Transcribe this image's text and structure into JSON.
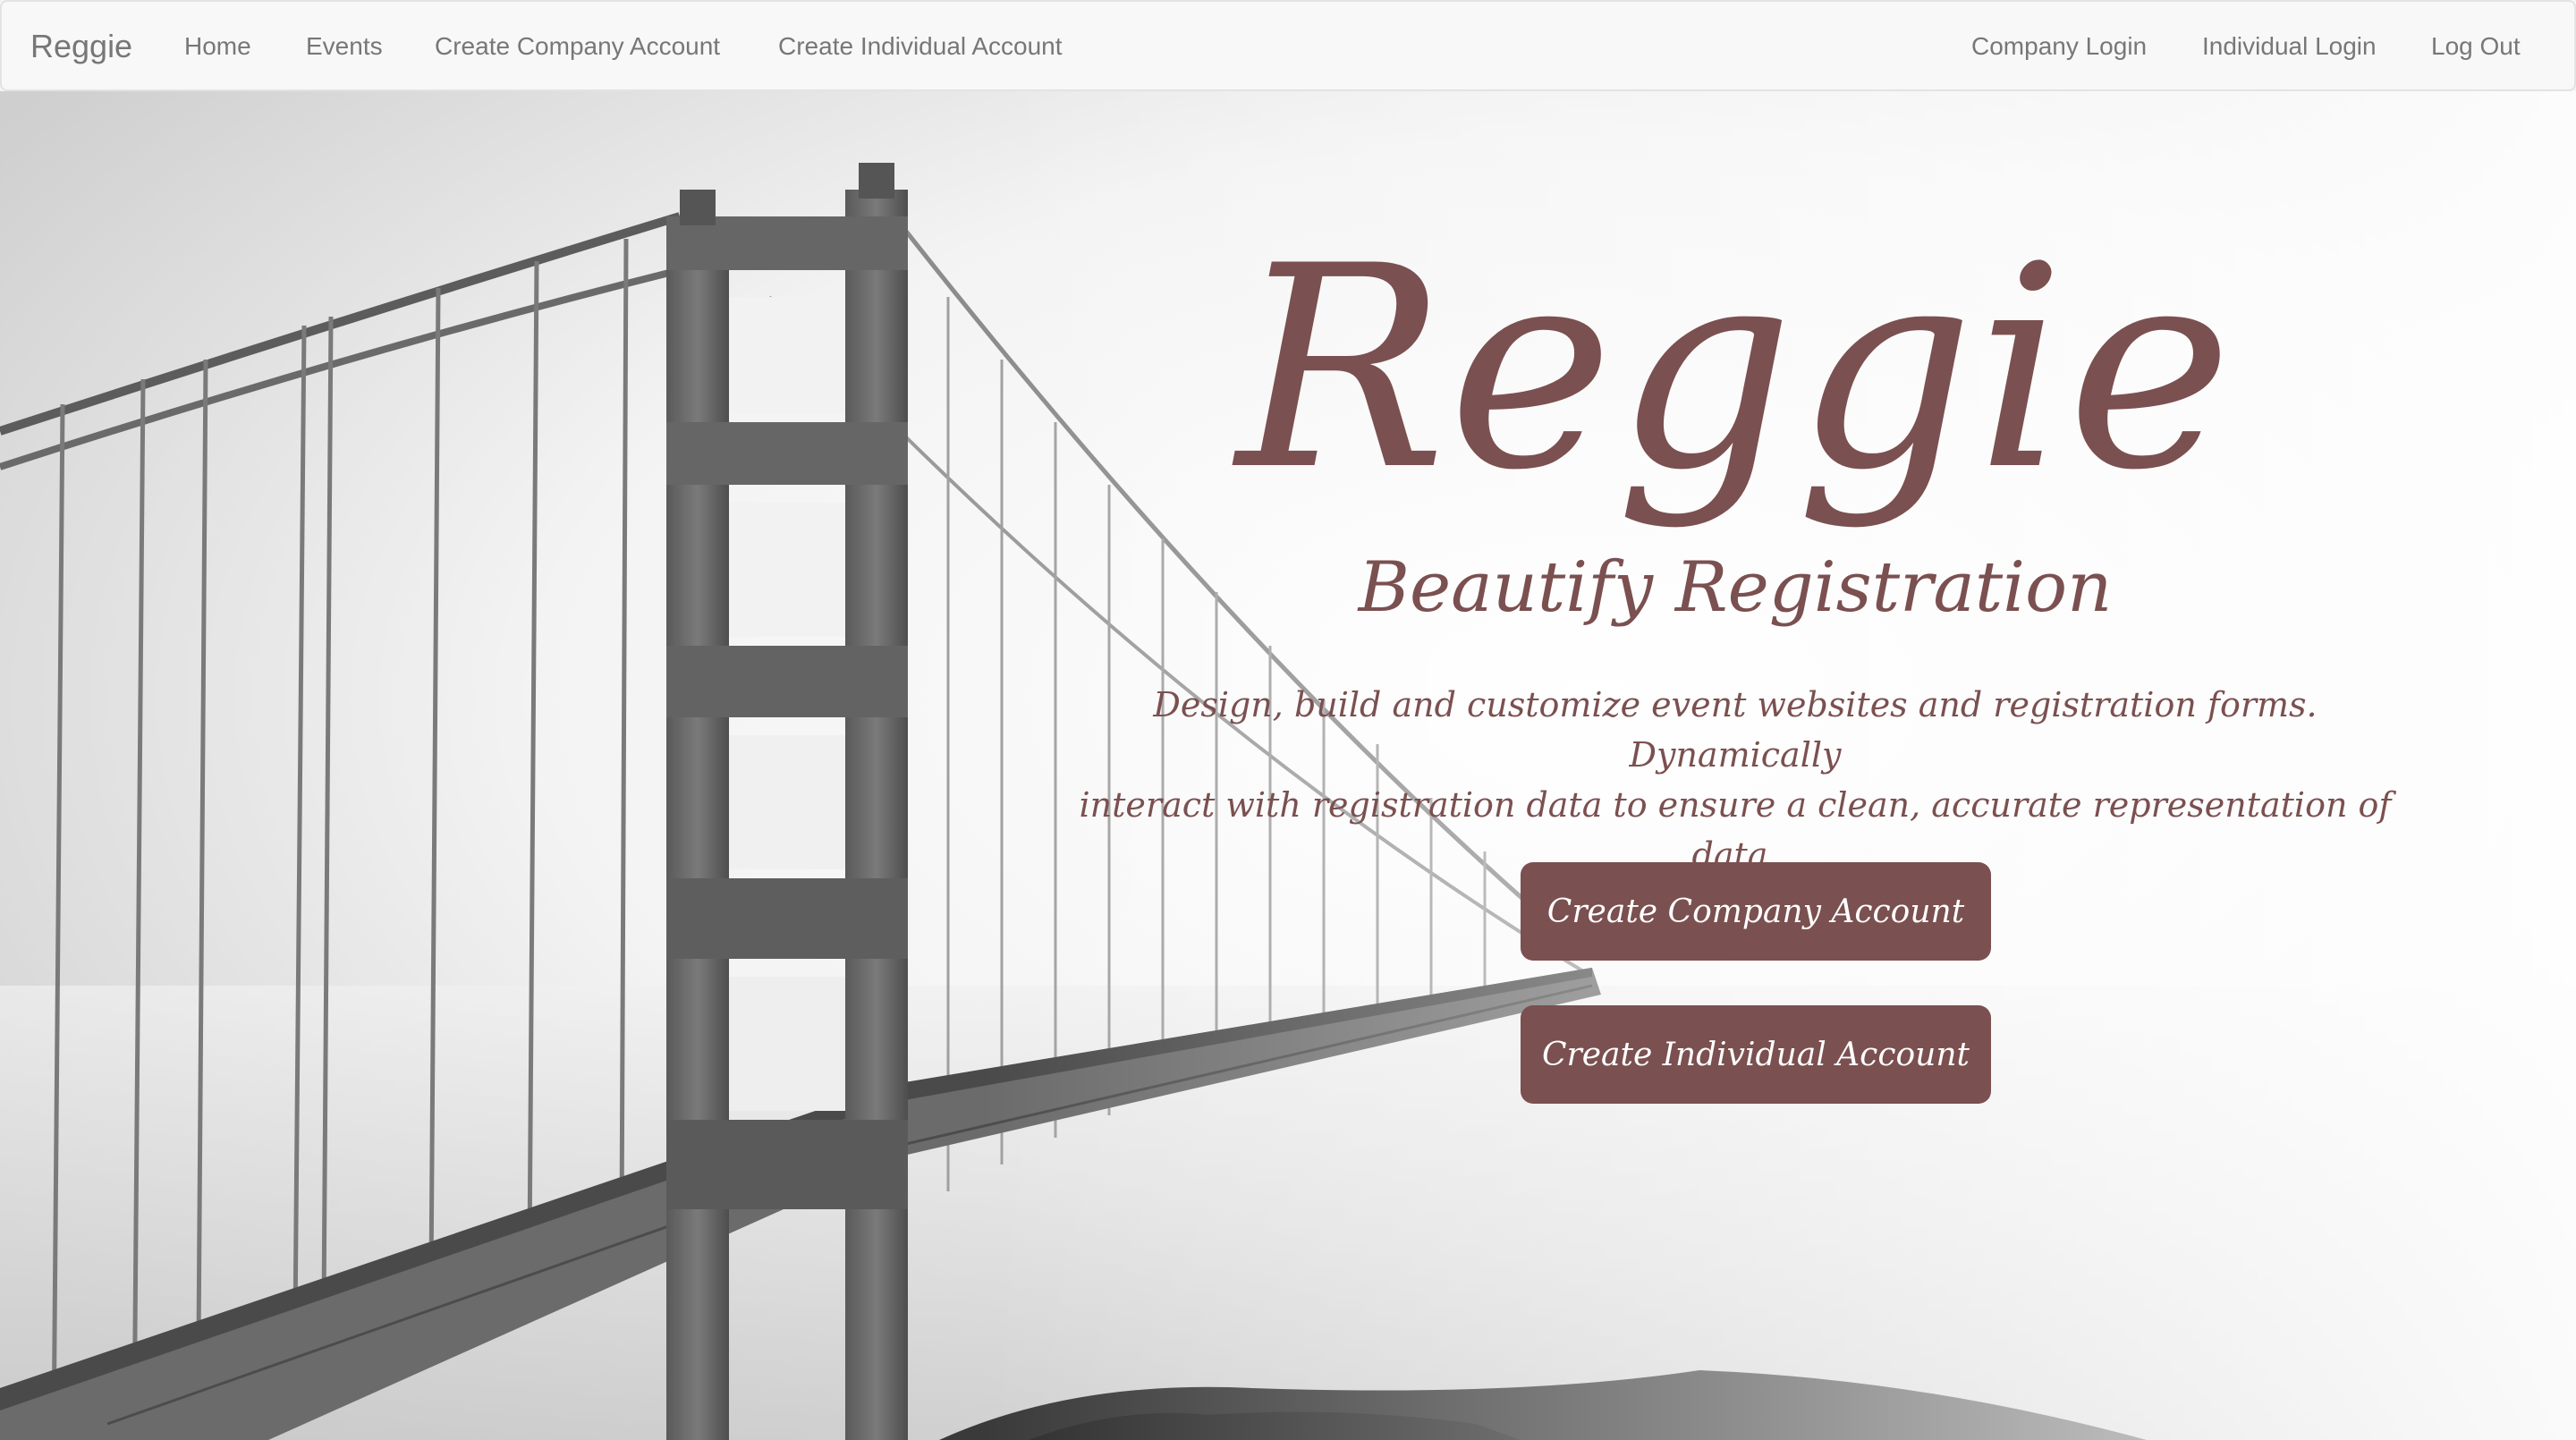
{
  "navbar": {
    "brand": "Reggie",
    "left_links": [
      {
        "label": "Home"
      },
      {
        "label": "Events"
      },
      {
        "label": "Create Company Account"
      },
      {
        "label": "Create Individual Account"
      }
    ],
    "right_links": [
      {
        "label": "Company Login"
      },
      {
        "label": "Individual Login"
      },
      {
        "label": "Log Out"
      }
    ]
  },
  "hero": {
    "background": "bridge-fog-photo",
    "title": "Reggie",
    "subtitle": "Beautify Registration",
    "description_line1": "Design, build and customize event websites and registration forms. Dynamically",
    "description_line2": "interact with registration data to ensure a clean, accurate representation of data.",
    "buttons": [
      {
        "label": "Create Company Account"
      },
      {
        "label": "Create Individual Account"
      }
    ]
  },
  "colors": {
    "accent": "#7b5050",
    "nav_text": "#777777",
    "nav_bg": "#f8f8f8"
  }
}
